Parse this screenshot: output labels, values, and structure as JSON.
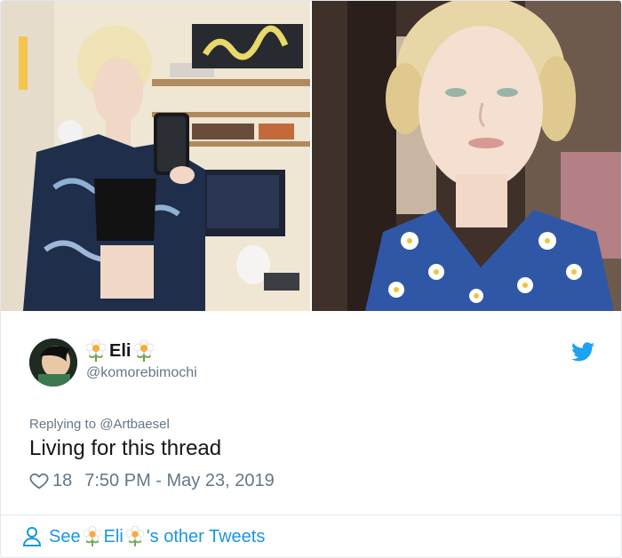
{
  "tweet": {
    "display_name": "Eli",
    "handle": "@komorebimochi",
    "reply_prefix": "Replying to",
    "reply_handle": "@Artbaesel",
    "text": "Living for this thread",
    "likes": "18",
    "timestamp": "7:50 PM - May 23, 2019"
  },
  "footer": {
    "see_label": "See",
    "name": "Eli",
    "suffix": "'s other Tweets"
  },
  "images": {
    "left": "photo-mirror-selfie",
    "right": "photo-close-up-portrait"
  },
  "icons": {
    "brand": "twitter-bird-icon",
    "like": "heart-icon",
    "profile": "person-icon",
    "emoji": "flower-emoji"
  },
  "colors": {
    "link": "#1b95e0",
    "secondary_text": "#657786",
    "primary_text": "#14171a",
    "border": "#e1e8ed"
  }
}
